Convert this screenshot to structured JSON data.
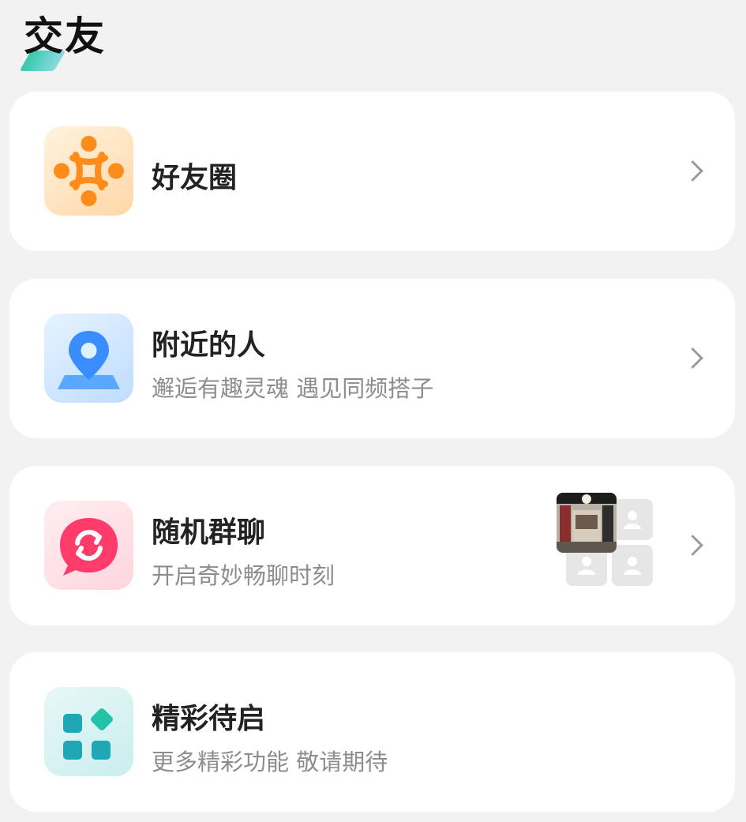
{
  "page": {
    "title": "交友"
  },
  "items": [
    {
      "title": "好友圈",
      "subtitle": "",
      "icon": "friends-circle-icon",
      "accent": "#ff8c1a"
    },
    {
      "title": "附近的人",
      "subtitle": "邂逅有趣灵魂 遇见同频搭子",
      "icon": "location-pin-icon",
      "accent": "#3a8dff"
    },
    {
      "title": "随机群聊",
      "subtitle": "开启奇妙畅聊时刻",
      "icon": "random-chat-icon",
      "accent": "#ff3b6b"
    },
    {
      "title": "精彩待启",
      "subtitle": "更多精彩功能 敬请期待",
      "icon": "apps-grid-icon",
      "accent": "#1fa7b5"
    }
  ]
}
